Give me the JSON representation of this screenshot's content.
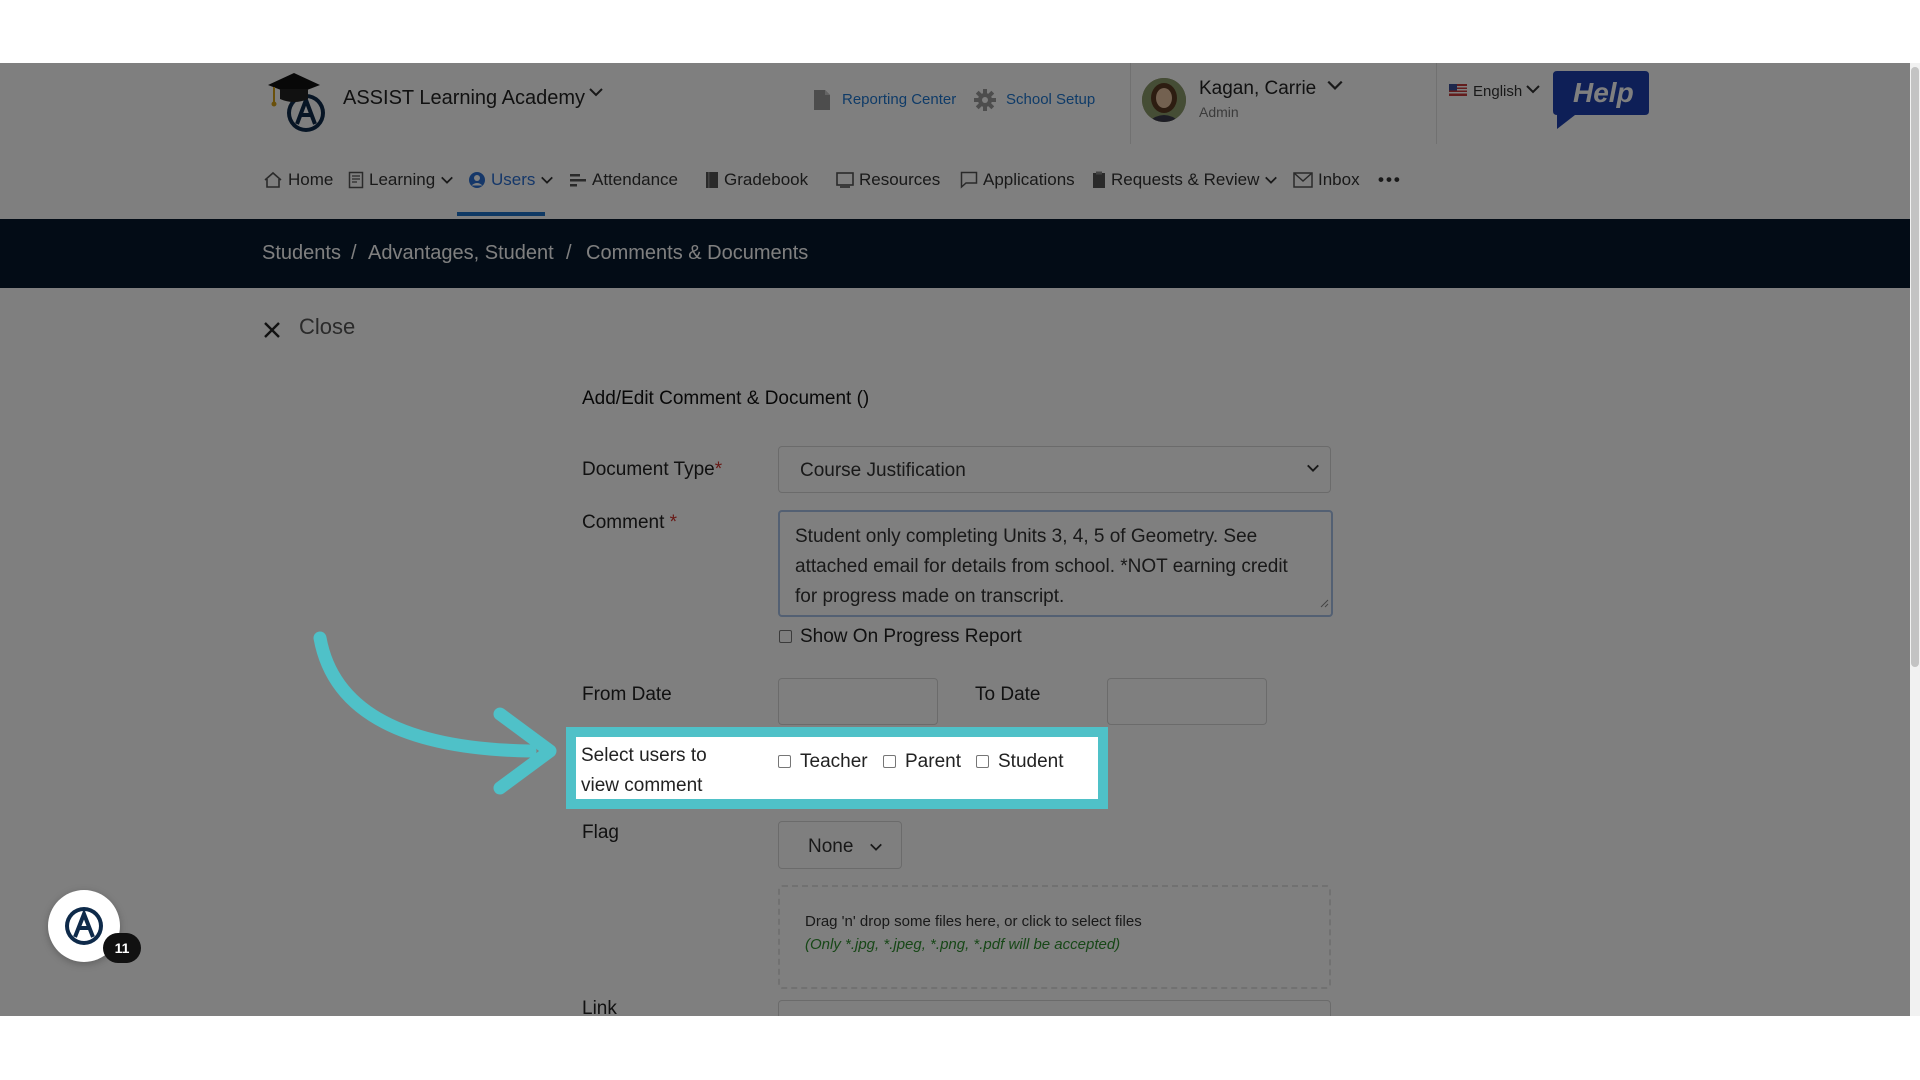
{
  "header": {
    "app_name": "ASSIST Learning Academy",
    "reporting_center": "Reporting Center",
    "school_setup": "School Setup",
    "user_name": "Kagan, Carrie",
    "user_role": "Admin",
    "language": "English",
    "help_label": "Help"
  },
  "nav": {
    "items": [
      {
        "label": "Home"
      },
      {
        "label": "Learning"
      },
      {
        "label": "Users"
      },
      {
        "label": "Attendance"
      },
      {
        "label": "Gradebook"
      },
      {
        "label": "Resources"
      },
      {
        "label": "Applications"
      },
      {
        "label": "Requests & Review"
      },
      {
        "label": "Inbox"
      }
    ],
    "active": "Users",
    "more_label": "•••"
  },
  "breadcrumb": {
    "items": [
      "Students",
      "Advantages, Student",
      "Comments & Documents"
    ],
    "separator": "/"
  },
  "form": {
    "close_label": "Close",
    "title": "Add/Edit Comment & Document ()",
    "document_type_label": "Document Type",
    "document_type_value": "Course Justification",
    "comment_label": "Comment",
    "required_mark": "*",
    "comment_value": "Student only completing Units 3, 4, 5 of Geometry. See attached email for details from school. *NOT earning credit for progress made on transcript.",
    "show_on_progress_label": "Show On Progress Report",
    "from_date_label": "From Date",
    "to_date_label": "To Date",
    "select_users_label": "Select users to view comment",
    "user_options": [
      {
        "label": "Teacher",
        "checked": false
      },
      {
        "label": "Parent",
        "checked": false
      },
      {
        "label": "Student",
        "checked": false
      }
    ],
    "flag_label": "Flag",
    "flag_value": "None",
    "dropzone_text": "Drag 'n' drop some files here, or click to select files",
    "dropzone_hint": "(Only *.jpg, *.jpeg, *.png, *.pdf will be accepted)",
    "link_label": "Link"
  },
  "widget": {
    "badge_count": "11"
  },
  "colors": {
    "accent": "#1e73c8",
    "breadcrumb_bg": "#06192d",
    "highlight": "#4fc1c8",
    "required": "#d0332c",
    "hint_green": "#2f8f2f"
  }
}
